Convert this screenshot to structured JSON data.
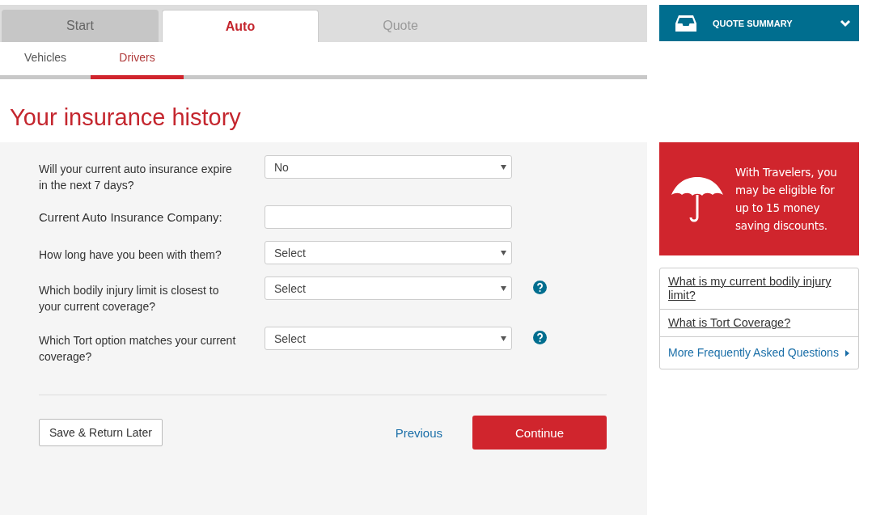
{
  "steps": [
    {
      "label": "Start",
      "selected": false,
      "done": true
    },
    {
      "label": "Auto",
      "selected": true,
      "done": false
    },
    {
      "label": "Quote",
      "selected": false,
      "done": false
    }
  ],
  "subtabs": [
    {
      "label": "Vehicles",
      "selected": false
    },
    {
      "label": "Drivers",
      "selected": true
    }
  ],
  "heading": "Your insurance history",
  "questions": [
    {
      "kind": "select",
      "label": "Will your current auto insurance expire in the next 7 days?",
      "value": "No",
      "help": false
    },
    {
      "kind": "text",
      "label": "Current Auto Insurance Company:",
      "help": false
    },
    {
      "kind": "select",
      "label": "How long have you been with them?",
      "value": "Select",
      "help": false
    },
    {
      "kind": "select",
      "label": "Which bodily injury limit is closest to your current coverage?",
      "value": "Select",
      "help": true
    },
    {
      "kind": "select",
      "label": "Which Tort option matches your current coverage?",
      "value": "Select",
      "help": true
    }
  ],
  "buttons": {
    "save": "Save & Return Later",
    "previous": "Previous",
    "continue": "Continue"
  },
  "summary": {
    "title": "QUOTE SUMMARY",
    "expanded": false
  },
  "promo": "With Travelers, you may be eligible for up to 15 money saving discounts.",
  "faq": [
    {
      "kind": "question",
      "label": "What is my current bodily injury limit?"
    },
    {
      "kind": "question",
      "label": "What is Tort Coverage?"
    },
    {
      "kind": "more",
      "label": "More Frequently Asked Questions"
    }
  ]
}
